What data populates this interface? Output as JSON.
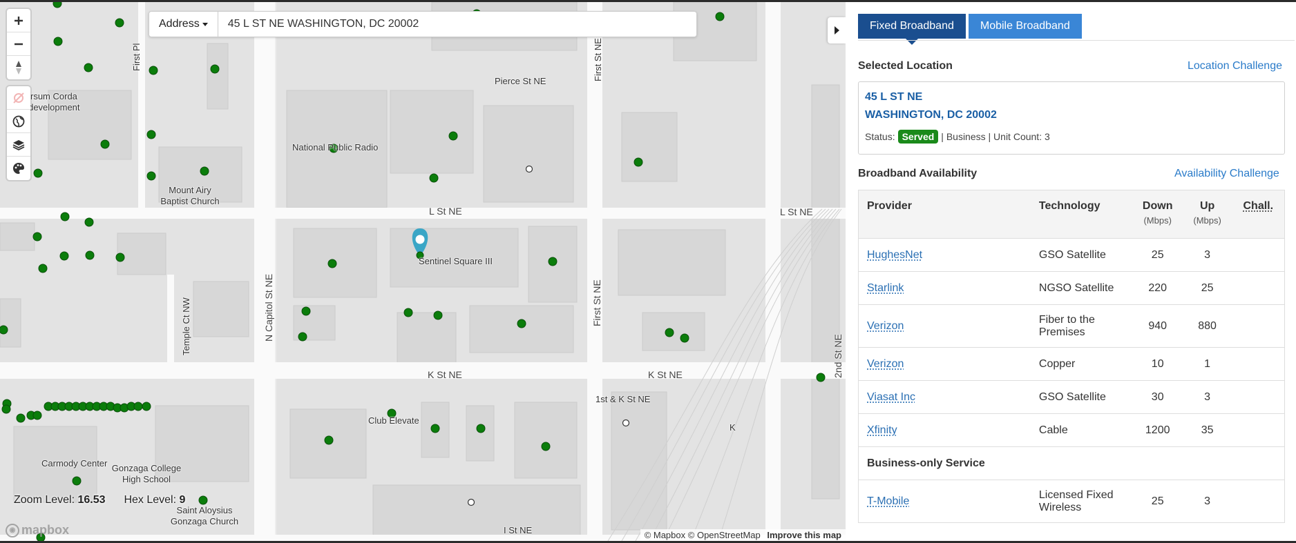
{
  "map": {
    "address_dropdown_label": "Address",
    "address_value": "45 L ST NE WASHINGTON, DC 20002",
    "labels": {
      "first_pl": "First Pl",
      "pierce_st": "Pierce St NE",
      "first_st_top": "First St NE",
      "sursum_corda": "Sursum Corda",
      "redevelopment": "Redevelopment",
      "npr": "National Public Radio",
      "mount_airy_1": "Mount Airy",
      "mount_airy_2": "Baptist Church",
      "l_st_1": "L St NE",
      "l_st_2": "L St NE",
      "sentinel": "Sentinel Square III",
      "n_capitol": "N Capitol St NE",
      "first_st_mid": "First St NE",
      "temple_ct": "Temple Ct NW",
      "k_st_1": "K St NE",
      "k_st_2": "K St NE",
      "second_st": "2nd St NE",
      "first_k": "1st & K St NE",
      "k_label": "K",
      "club_elevate": "Club Elevate",
      "carmody": "Carmody Center",
      "gonzaga_1": "Gonzaga College",
      "gonzaga_2": "High School",
      "saint_1": "Saint Aloysius",
      "saint_2": "Gonzaga Church",
      "i_st": "I St NE"
    },
    "zoom_label": "Zoom Level:",
    "zoom_value": "16.53",
    "hex_label": "Hex Level:",
    "hex_value": "9",
    "logo_text": "mapbox",
    "attribution": {
      "mapbox": "© Mapbox",
      "osm": "© OpenStreetMap",
      "improve": "Improve this map"
    },
    "colors": {
      "served_dot": "#0b7d0b",
      "pin": "#3aa6c6"
    }
  },
  "panel": {
    "tabs": [
      {
        "label": "Fixed Broadband",
        "active": true
      },
      {
        "label": "Mobile Broadband",
        "active": false
      }
    ],
    "selected_location_title": "Selected Location",
    "location_challenge": "Location Challenge",
    "location": {
      "line1": "45 L ST NE",
      "line2": "WASHINGTON, DC 20002",
      "status_label": "Status:",
      "status_value": "Served",
      "status_rest": "| Business | Unit Count: 3"
    },
    "availability_title": "Broadband Availability",
    "availability_challenge": "Availability Challenge",
    "table": {
      "headers": {
        "provider": "Provider",
        "technology": "Technology",
        "down": "Down",
        "down_unit": "(Mbps)",
        "up": "Up",
        "up_unit": "(Mbps)",
        "chall": "Chall."
      },
      "rows": [
        {
          "provider": "HughesNet",
          "technology": "GSO Satellite",
          "down": "25",
          "up": "3"
        },
        {
          "provider": "Starlink",
          "technology": "NGSO Satellite",
          "down": "220",
          "up": "25"
        },
        {
          "provider": "Verizon",
          "technology": "Fiber to the Premises",
          "down": "940",
          "up": "880"
        },
        {
          "provider": "Verizon",
          "technology": "Copper",
          "down": "10",
          "up": "1"
        },
        {
          "provider": "Viasat Inc",
          "technology": "GSO Satellite",
          "down": "30",
          "up": "3"
        },
        {
          "provider": "Xfinity",
          "technology": "Cable",
          "down": "1200",
          "up": "35"
        }
      ],
      "group_label": "Business-only Service",
      "business_rows": [
        {
          "provider": "T-Mobile",
          "technology": "Licensed Fixed Wireless",
          "down": "25",
          "up": "3"
        }
      ]
    },
    "colors": {
      "tab_active": "#1a4e8f",
      "tab_inactive": "#3a86d6",
      "link": "#2a7bc9",
      "served_badge": "#1a8a1a"
    }
  }
}
